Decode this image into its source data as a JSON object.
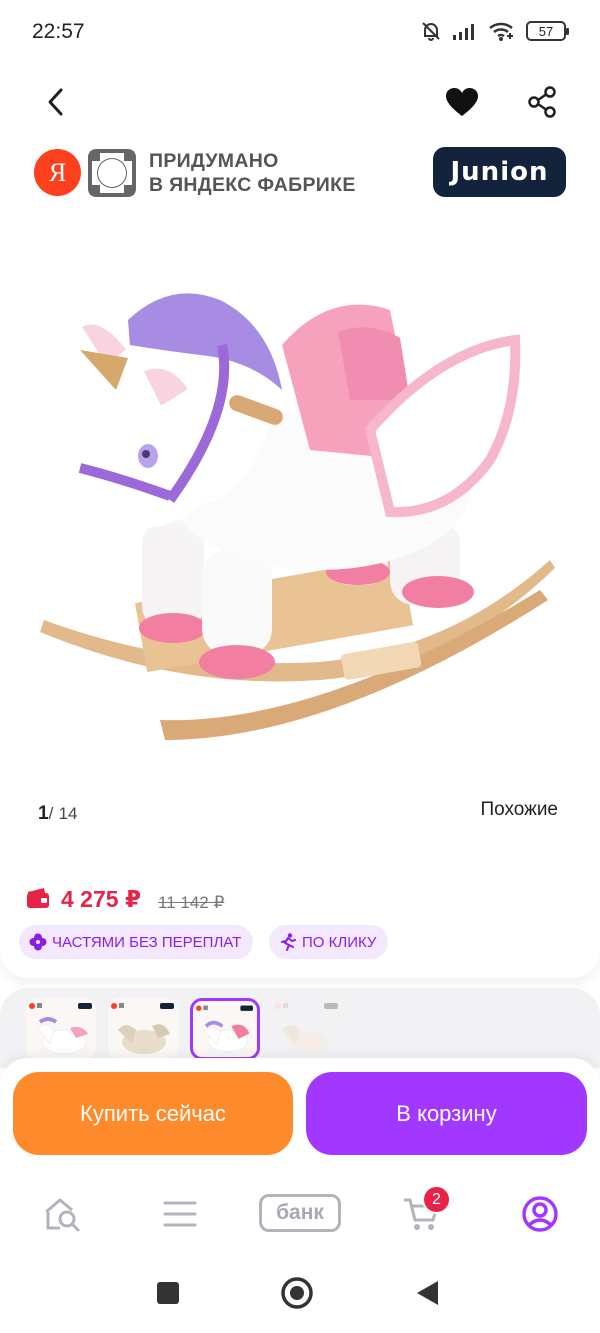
{
  "status_bar": {
    "time": "22:57",
    "battery": "57"
  },
  "brand": {
    "ya_letter": "Я",
    "line1": "ПРИДУМАНО",
    "line2": "В ЯНДЕКС ФАБРИКЕ",
    "partner": "Junion"
  },
  "gallery": {
    "current": "1",
    "separator": "/",
    "total": "14",
    "similar_label": "Похожие"
  },
  "price": {
    "current": "4 275 ₽",
    "old": "11 142 ₽",
    "badge_installments": "ЧАСТЯМИ БЕЗ ПЕРЕПЛАТ",
    "badge_one_click": "ПО КЛИКУ"
  },
  "actions": {
    "buy_now": "Купить сейчас",
    "add_to_cart": "В корзину"
  },
  "tabbar": {
    "bank": "банк",
    "cart_count": "2"
  },
  "colors": {
    "accent": "#a238ff",
    "buy": "#ff8a2b",
    "price": "#e8234a"
  },
  "icons": [
    "back-icon",
    "heart-icon",
    "share-icon",
    "wallet-icon",
    "clover-icon",
    "running-icon",
    "home-search-icon",
    "menu-icon",
    "cart-icon",
    "profile-icon"
  ]
}
